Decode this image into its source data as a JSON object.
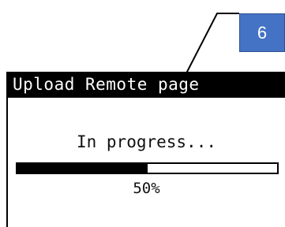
{
  "callout": {
    "number": "6",
    "color": "#4472C4"
  },
  "screen": {
    "title": "Upload Remote page",
    "status": "In progress...",
    "progress": {
      "fraction": 0.5,
      "label": "50%"
    }
  }
}
